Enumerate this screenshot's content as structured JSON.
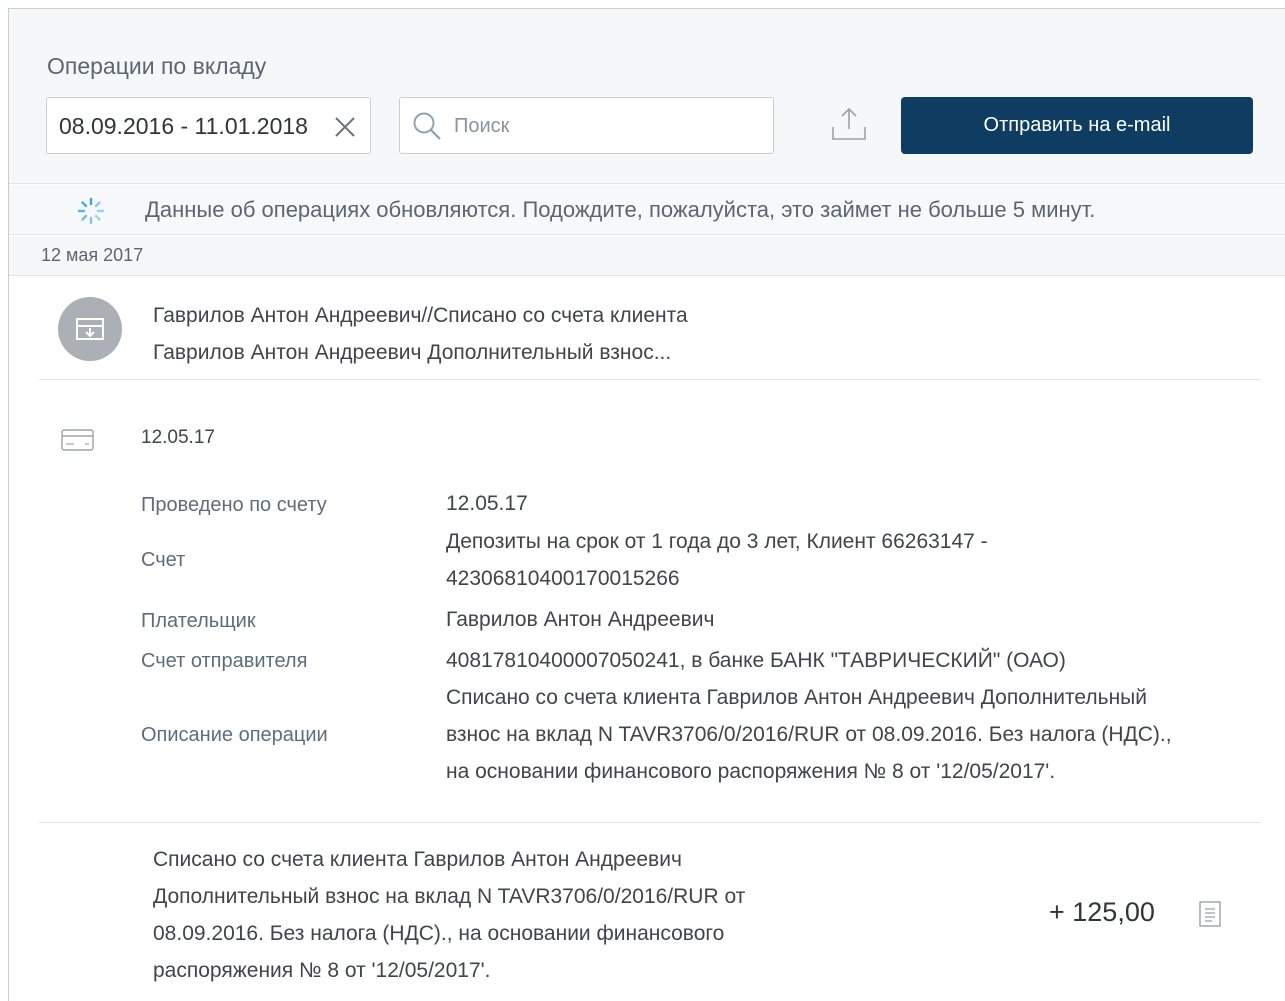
{
  "header": {
    "title": "Операции по вкладу",
    "date_range": "08.09.2016 - 11.01.2018",
    "search_placeholder": "Поиск",
    "send_button_label": "Отправить на e-mail"
  },
  "notice": {
    "text": "Данные об операциях обновляются. Подождите, пожалуйста, это займет не больше 5 минут."
  },
  "groups": [
    {
      "date_label": "12 мая 2017",
      "operation": {
        "title_lines": [
          "Гаврилов Антон Андреевич//Списано со счета клиента",
          "Гаврилов Антон Андреевич Дополнительный взнос..."
        ],
        "date": "12.05.17",
        "details": [
          {
            "label": "Проведено по счету",
            "value_lines": [
              "12.05.17"
            ]
          },
          {
            "label": "Счет",
            "value_lines": [
              "Депозиты на срок от 1 года до 3 лет, Клиент 66263147 -",
              "42306810400170015266"
            ]
          },
          {
            "label": "Плательщик",
            "value_lines": [
              "Гаврилов Антон Андреевич"
            ]
          },
          {
            "label": "Счет отправителя",
            "value_lines": [
              "40817810400007050241, в банке БАНК \"ТАВРИЧЕСКИЙ\" (ОАО)"
            ]
          },
          {
            "label": "Описание операции",
            "value_lines": [
              "Списано со счета клиента Гаврилов Антон Андреевич Дополнительный",
              "взнос на вклад N TAVR3706/0/2016/RUR от 08.09.2016. Без налога (НДС).,",
              "на основании финансового распоряжения № 8 от '12/05/2017'."
            ]
          }
        ],
        "summary_lines": [
          "Списано со счета клиента Гаврилов Антон Андреевич",
          "Дополнительный взнос на вклад N TAVR3706/0/2016/RUR от",
          "08.09.2016. Без налога (НДС)., на основании финансового",
          "распоряжения № 8 от '12/05/2017'."
        ],
        "amount_main": "+ 125,",
        "amount_cents": "00"
      }
    }
  ],
  "colors": {
    "accent_button": "#0e3d61",
    "icon_gray": "#aab0b5",
    "spinner": "#3aa3e3"
  }
}
